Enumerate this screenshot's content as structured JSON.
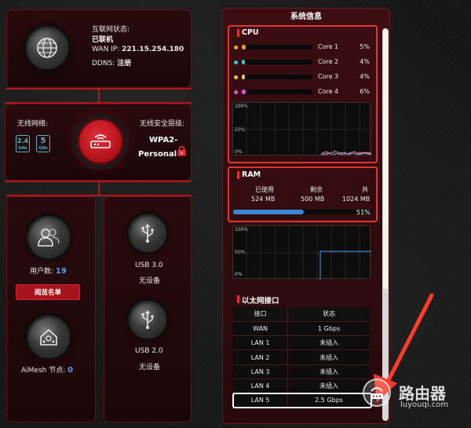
{
  "internet": {
    "status_label": "互联网状态:",
    "status_value": "已联机",
    "wan_ip_label": "WAN IP:",
    "wan_ip_value": "221.15.254.180",
    "ddns_label": "DDNS:",
    "ddns_value": "注册",
    "icon": "globe-icon"
  },
  "wireless": {
    "network_label": "无线网络:",
    "band_24": "2.4",
    "band_5": "5",
    "band_unit": "GHz",
    "security_label": "无线安全层级:",
    "security_value_1": "WPA2-",
    "security_value_2": "Personal",
    "lock_icon": "lock-icon"
  },
  "clients": {
    "label": "用户数:",
    "count": "19",
    "view_list_button": "阅览名单",
    "icon": "users-icon"
  },
  "aimesh": {
    "label": "AiMesh 节点:",
    "count": "0",
    "icon": "aimesh-icon"
  },
  "usb": [
    {
      "name": "USB 3.0",
      "status": "无设备"
    },
    {
      "name": "USB 2.0",
      "status": "无设备"
    }
  ],
  "system_info": {
    "title": "系统信息",
    "cpu": {
      "heading": "CPU",
      "cores": [
        {
          "name": "Core 1",
          "value": "5%",
          "fraction": 0.05,
          "color": "#f0a034"
        },
        {
          "name": "Core 2",
          "value": "4%",
          "fraction": 0.04,
          "color": "#3fc4c4"
        },
        {
          "name": "Core 3",
          "value": "4%",
          "fraction": 0.04,
          "color": "#e8c84a"
        },
        {
          "name": "Core 4",
          "value": "6%",
          "fraction": 0.06,
          "color": "#d85ad8"
        }
      ],
      "graph_ticks": [
        "100%",
        "50%",
        "0%"
      ]
    },
    "ram": {
      "heading": "RAM",
      "used_label": "已使用",
      "used_value": "524 MB",
      "free_label": "剩余",
      "free_value": "500 MB",
      "total_label": "共",
      "total_value": "1024 MB",
      "percent": "51%",
      "fraction": 0.51,
      "graph_ticks": [
        "100%",
        "50%",
        "0%"
      ]
    },
    "ethernet": {
      "heading": "以太网接口",
      "col_port": "接口",
      "col_status": "状态",
      "rows": [
        {
          "port": "WAN",
          "status": "1 Gbps"
        },
        {
          "port": "LAN 1",
          "status": "未插入"
        },
        {
          "port": "LAN 2",
          "status": "未插入"
        },
        {
          "port": "LAN 3",
          "status": "未插入"
        },
        {
          "port": "LAN 4",
          "status": "未插入"
        },
        {
          "port": "LAN 5",
          "status": "2.5 Gbps"
        }
      ]
    }
  },
  "watermark": {
    "text": "路由器",
    "url": "luyouqi.com"
  },
  "colors": {
    "accent_red": "#e2352f",
    "router_red": "#b8141c",
    "ram_blue": "#3b86d6",
    "client_blue": "#4fa3e8"
  }
}
